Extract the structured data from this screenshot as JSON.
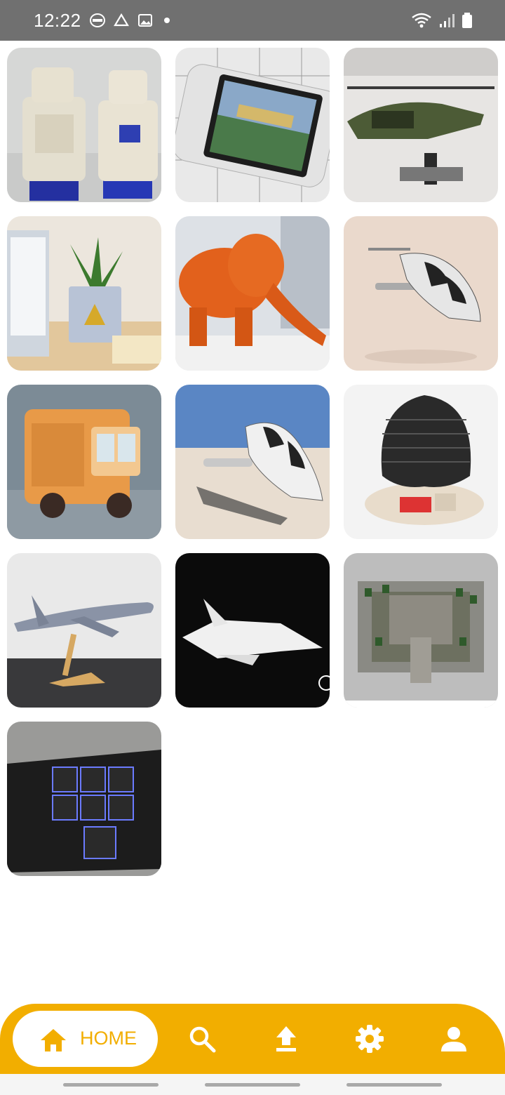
{
  "status_bar": {
    "time": "12:22",
    "left_icons": [
      "burger-king-notification-icon",
      "drive-notification-icon",
      "gallery-notification-icon",
      "dot-icon"
    ],
    "right_icons": [
      "wifi-icon",
      "signal-icon",
      "battery-icon"
    ]
  },
  "grid": {
    "items": [
      {
        "name": "robot-figurines"
      },
      {
        "name": "game-console-zelda"
      },
      {
        "name": "helicopter-model"
      },
      {
        "name": "plant-pot-triforce"
      },
      {
        "name": "orange-elephant"
      },
      {
        "name": "flying-car-render"
      },
      {
        "name": "toy-truck"
      },
      {
        "name": "flying-car-desert"
      },
      {
        "name": "darth-vader-helmet"
      },
      {
        "name": "jumbo-jet-model"
      },
      {
        "name": "fighter-jet-model"
      },
      {
        "name": "stepped-garden-building"
      },
      {
        "name": "keyboard-case"
      }
    ]
  },
  "bottom_nav": {
    "home_label": "HOME",
    "items": [
      "home-icon",
      "search-icon",
      "upload-icon",
      "settings-icon",
      "profile-icon"
    ],
    "accent_color": "#f2ae00"
  }
}
